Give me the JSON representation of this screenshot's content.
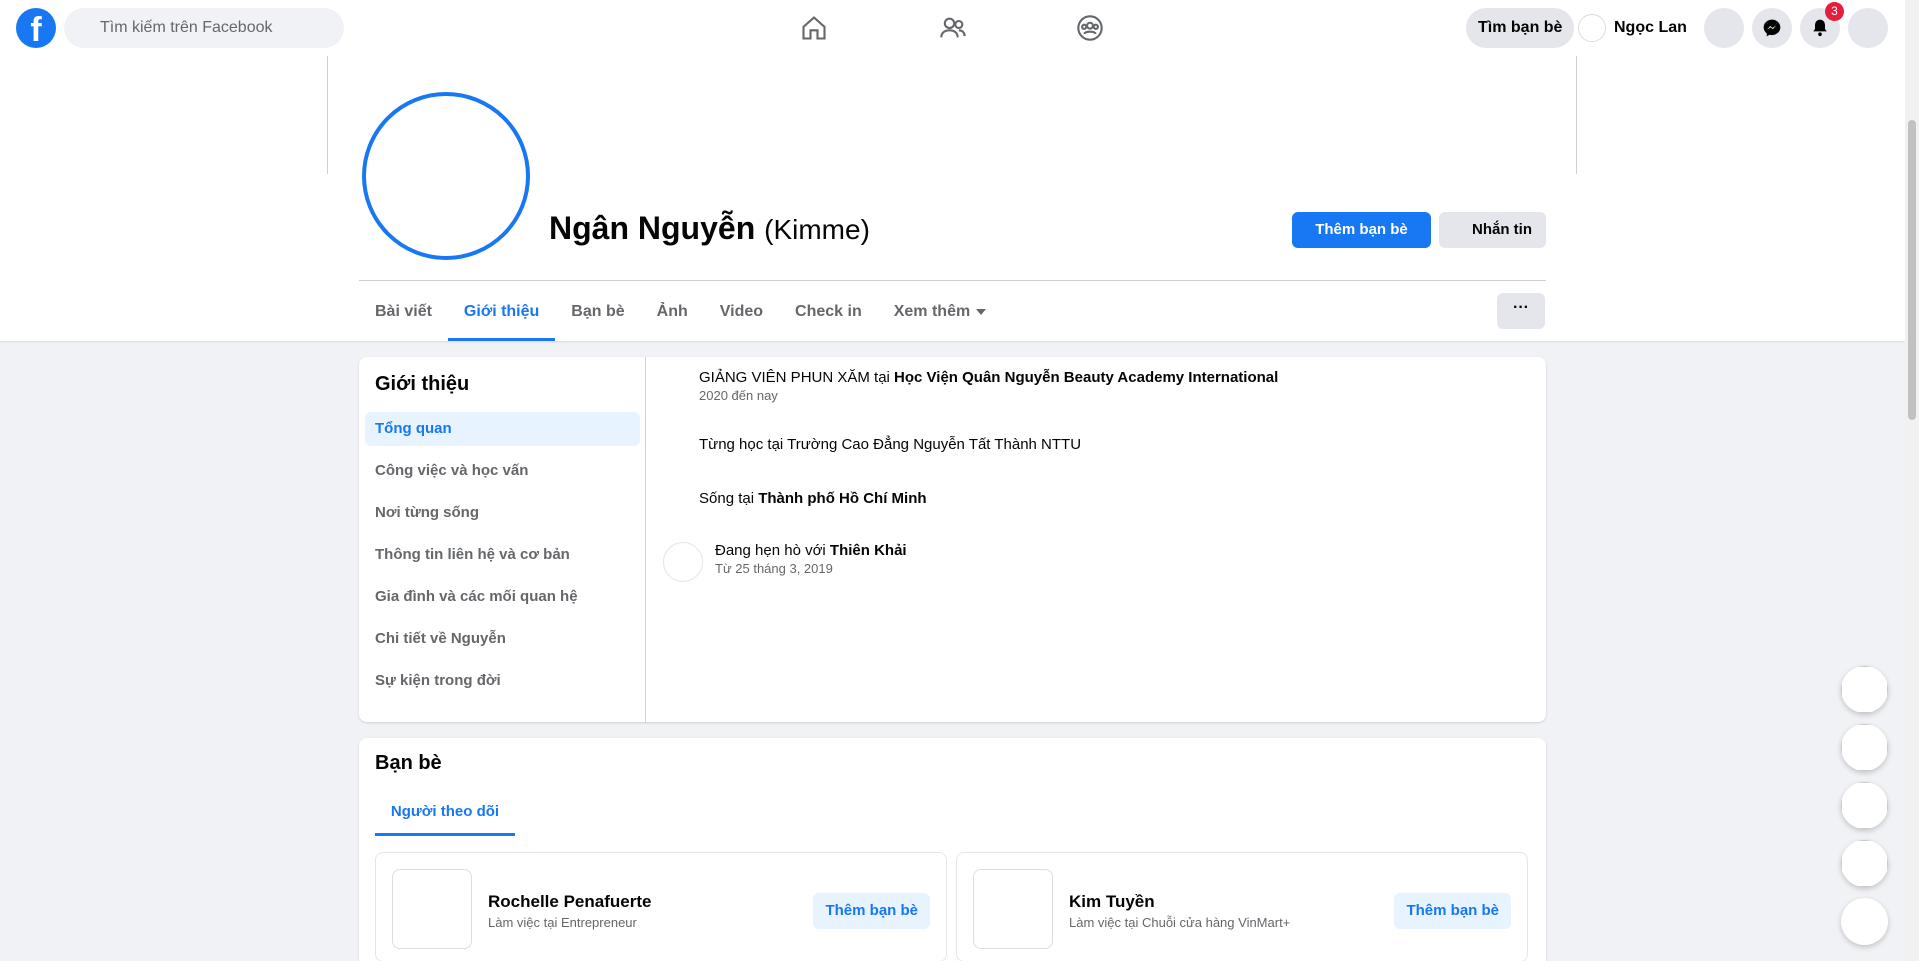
{
  "topbar": {
    "logo": "f",
    "search_placeholder": "Tìm kiếm trên Facebook",
    "find_friends": "Tìm bạn bè",
    "user_name": "Ngọc Lan",
    "notification_count": "3",
    "icons": [
      "home-icon",
      "friends-icon",
      "groups-icon",
      "messenger-icon",
      "bell-icon"
    ]
  },
  "profile": {
    "name": "Ngân Nguyễn",
    "alternate_name": "(Kimme)",
    "add_friend": "Thêm bạn bè",
    "message": "Nhắn tin",
    "more": "···"
  },
  "tabs": [
    {
      "label": "Bài viết"
    },
    {
      "label": "Giới thiệu"
    },
    {
      "label": "Bạn bè"
    },
    {
      "label": "Ảnh"
    },
    {
      "label": "Video"
    },
    {
      "label": "Check in"
    },
    {
      "label": "Xem thêm"
    }
  ],
  "about": {
    "title": "Giới thiệu",
    "menu": [
      {
        "label": "Tổng quan"
      },
      {
        "label": "Công việc và học vấn"
      },
      {
        "label": "Nơi từng sống"
      },
      {
        "label": "Thông tin liên hệ và cơ bản"
      },
      {
        "label": "Gia đình và các mối quan hệ"
      },
      {
        "label": "Chi tiết về Nguyễn"
      },
      {
        "label": "Sự kiện trong đời"
      }
    ],
    "work": {
      "prefix": "GIẢNG VIÊN PHUN XĂM tại ",
      "place": "Học Viện Quân Nguyễn Beauty Academy International",
      "sub": "2020 đến nay"
    },
    "education": {
      "text": "Từng học tại Trường Cao Đẳng Nguyễn Tất Thành NTTU"
    },
    "lives": {
      "prefix": "Sống tại ",
      "place": "Thành phố Hồ Chí Minh"
    },
    "relationship": {
      "prefix": "Đang hẹn hò với ",
      "person": "Thiên Khải",
      "sub": "Từ 25 tháng 3, 2019"
    }
  },
  "friends": {
    "title": "Bạn bè",
    "tab": "Người theo dõi",
    "items": [
      {
        "name": "Rochelle Penafuerte",
        "sub": "Làm việc tại Entrepreneur",
        "button": "Thêm bạn bè"
      },
      {
        "name": "Kim Tuyền",
        "sub": "Làm việc tại Chuỗi cửa hàng VinMart+",
        "button": "Thêm bạn bè"
      }
    ]
  },
  "colors": {
    "accent": "#1877f2",
    "background": "#f0f2f5",
    "badge": "#e41e3f"
  }
}
